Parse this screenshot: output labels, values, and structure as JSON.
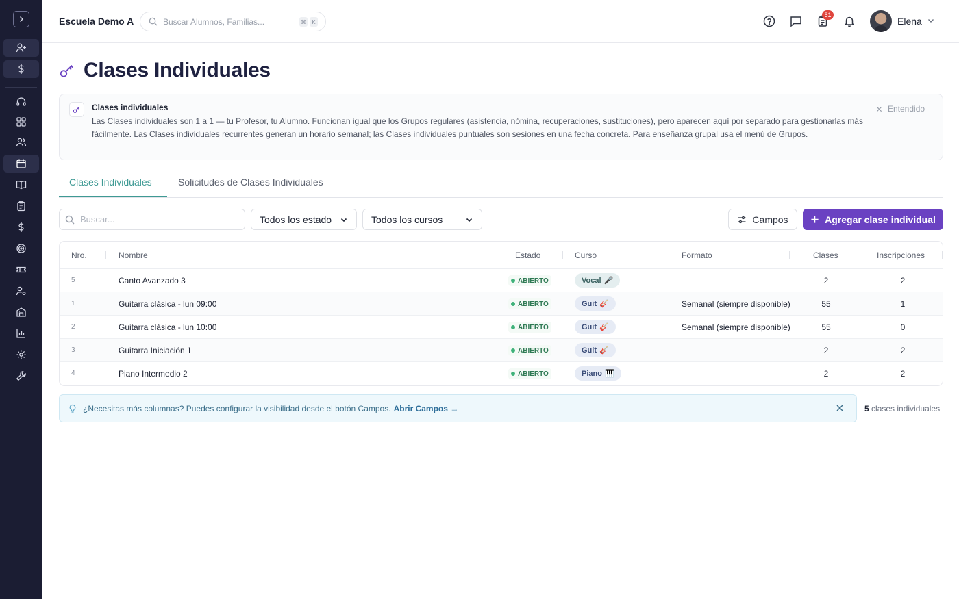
{
  "topbar": {
    "school_name": "Escuela Demo A",
    "search_placeholder": "Buscar Alumnos, Familias...",
    "shortcut_keys": [
      "⌘",
      "K"
    ],
    "notification_count": "51",
    "user_name": "Elena"
  },
  "page": {
    "title": "Clases Individuales"
  },
  "info": {
    "title": "Clases individuales",
    "body": "Las Clases individuales son 1 a 1 — tu Profesor, tu Alumno. Funcionan igual que los Grupos regulares (asistencia, nómina, recuperaciones, sustituciones), pero aparecen aquí por separado para gestionarlas más fácilmente. Las Clases individuales recurrentes generan un horario semanal; las Clases individuales puntuales son sesiones en una fecha concreta. Para enseñanza grupal usa el menú de Grupos.",
    "dismiss_label": "Entendido"
  },
  "tabs": [
    {
      "label": "Clases Individuales",
      "active": true
    },
    {
      "label": "Solicitudes de Clases Individuales",
      "active": false
    }
  ],
  "toolbar": {
    "search_placeholder": "Buscar...",
    "status_filter": "Todos los estado",
    "course_filter": "Todos los cursos",
    "fields_button": "Campos",
    "add_button": "Agregar clase individual"
  },
  "table": {
    "columns": [
      "Nro.",
      "Nombre",
      "Estado",
      "Curso",
      "Formato",
      "Clases",
      "Inscripciones"
    ],
    "rows": [
      {
        "nro": "5",
        "nombre": "Canto Avanzado 3",
        "estado": "ABIERTO",
        "curso": "Vocal",
        "curso_emoji": "🎤",
        "formato": "",
        "clases": "2",
        "inscripciones": "2"
      },
      {
        "nro": "1",
        "nombre": "Guitarra clásica - lun 09:00",
        "estado": "ABIERTO",
        "curso": "Guit",
        "curso_emoji": "🎸",
        "formato": "Semanal (siempre disponible)",
        "clases": "55",
        "inscripciones": "1"
      },
      {
        "nro": "2",
        "nombre": "Guitarra clásica - lun 10:00",
        "estado": "ABIERTO",
        "curso": "Guit",
        "curso_emoji": "🎸",
        "formato": "Semanal (siempre disponible)",
        "clases": "55",
        "inscripciones": "0"
      },
      {
        "nro": "3",
        "nombre": "Guitarra Iniciación 1",
        "estado": "ABIERTO",
        "curso": "Guit",
        "curso_emoji": "🎸",
        "formato": "",
        "clases": "2",
        "inscripciones": "2"
      },
      {
        "nro": "4",
        "nombre": "Piano Intermedio 2",
        "estado": "ABIERTO",
        "curso": "Piano",
        "curso_emoji": "🎹",
        "formato": "",
        "clases": "2",
        "inscripciones": "2"
      }
    ]
  },
  "tip": {
    "text": "¿Necesitas más columnas? Puedes configurar la visibilidad desde el botón Campos.",
    "link": "Abrir Campos →"
  },
  "footer": {
    "count": "5",
    "count_label": "clases individuales"
  },
  "colors": {
    "sidebar_bg": "#1b1d33",
    "accent_teal": "#3f9a94",
    "primary_purple": "#6a42c2",
    "status_green": "#3fb27a"
  }
}
